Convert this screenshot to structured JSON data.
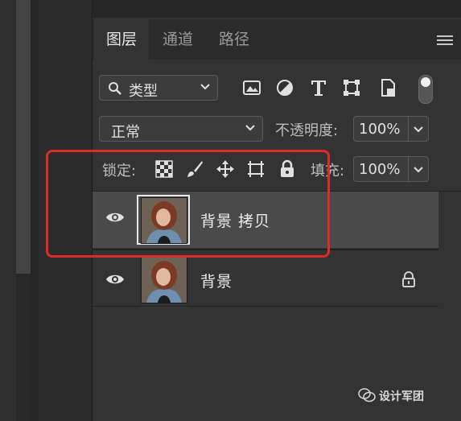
{
  "tabs": [
    {
      "label": "图层",
      "active": true
    },
    {
      "label": "通道",
      "active": false
    },
    {
      "label": "路径",
      "active": false
    }
  ],
  "filter": {
    "label": "类型"
  },
  "filter_icons": [
    "image-filter-icon",
    "adjustment-filter-icon",
    "type-filter-icon",
    "shape-filter-icon",
    "smart-object-filter-icon",
    "filter-toggle-icon"
  ],
  "blend": {
    "mode": "正常",
    "opacity_label": "不透明度:",
    "opacity_value": "100%"
  },
  "lock": {
    "label": "锁定:",
    "icons": [
      "lock-transparent-icon",
      "lock-image-icon",
      "lock-position-icon",
      "lock-artboard-icon",
      "lock-all-icon"
    ],
    "fill_label": "填充:",
    "fill_value": "100%"
  },
  "layers": [
    {
      "name": "背景 拷贝",
      "visible": true,
      "selected": true,
      "locked": false
    },
    {
      "name": "背景",
      "visible": true,
      "selected": false,
      "locked": true
    }
  ],
  "watermark": "设计军团",
  "colors": {
    "accent_annotation": "#e02a2a",
    "panel_bg": "#333333",
    "selected_row": "#4a4a4a"
  }
}
